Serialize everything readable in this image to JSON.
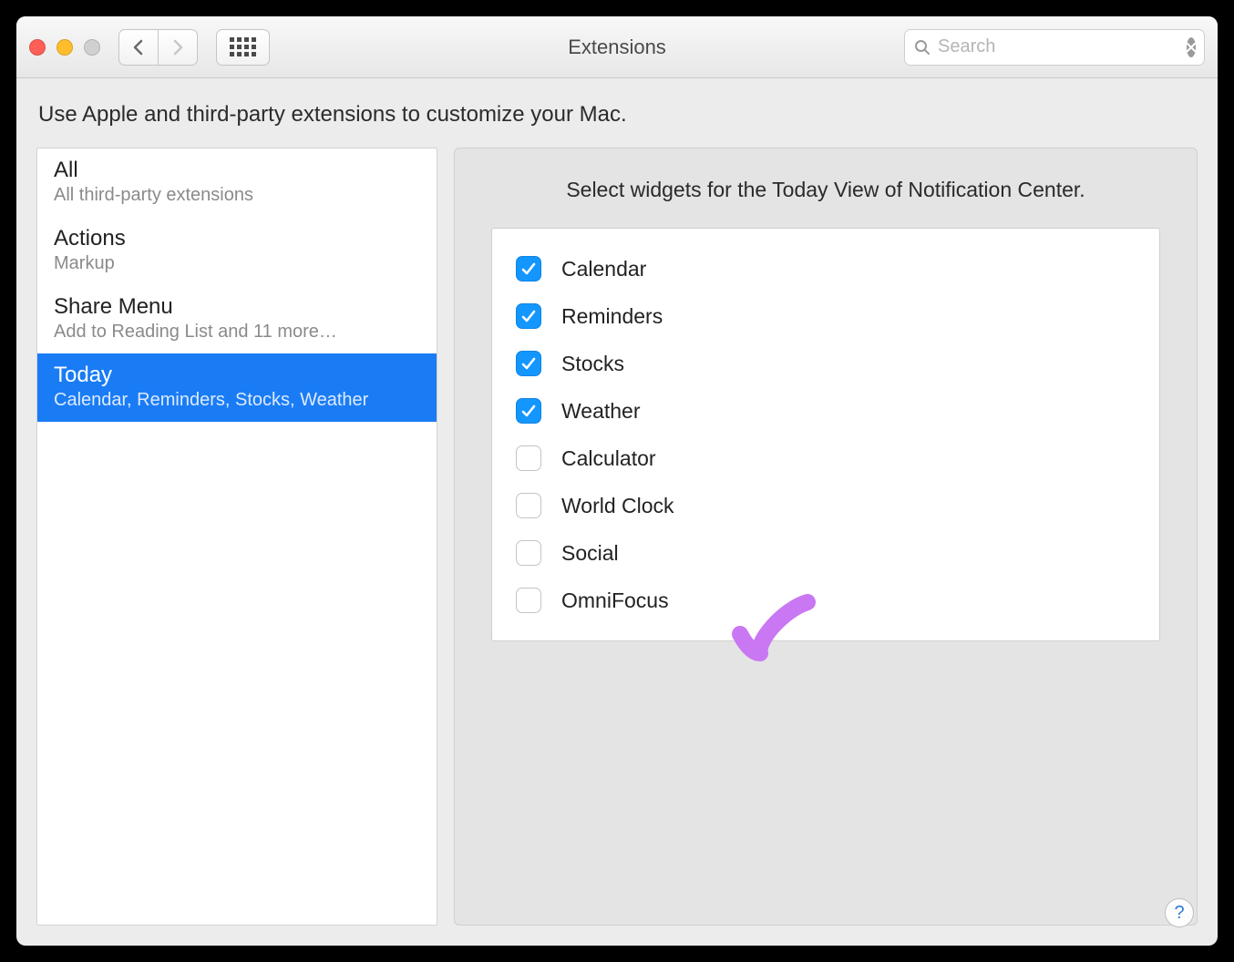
{
  "window": {
    "title": "Extensions"
  },
  "search": {
    "placeholder": "Search",
    "value": ""
  },
  "intro": "Use Apple and third-party extensions to customize your Mac.",
  "sidebar": {
    "items": [
      {
        "title": "All",
        "sub": "All third-party extensions",
        "selected": false
      },
      {
        "title": "Actions",
        "sub": "Markup",
        "selected": false
      },
      {
        "title": "Share Menu",
        "sub": "Add to Reading List and 11 more…",
        "selected": false
      },
      {
        "title": "Today",
        "sub": "Calendar, Reminders, Stocks, Weather",
        "selected": true
      }
    ]
  },
  "detail": {
    "title": "Select widgets for the Today View of Notification Center.",
    "widgets": [
      {
        "label": "Calendar",
        "checked": true
      },
      {
        "label": "Reminders",
        "checked": true
      },
      {
        "label": "Stocks",
        "checked": true
      },
      {
        "label": "Weather",
        "checked": true
      },
      {
        "label": "Calculator",
        "checked": false
      },
      {
        "label": "World Clock",
        "checked": false
      },
      {
        "label": "Social",
        "checked": false
      },
      {
        "label": "OmniFocus",
        "checked": false
      }
    ]
  },
  "help_label": "?"
}
